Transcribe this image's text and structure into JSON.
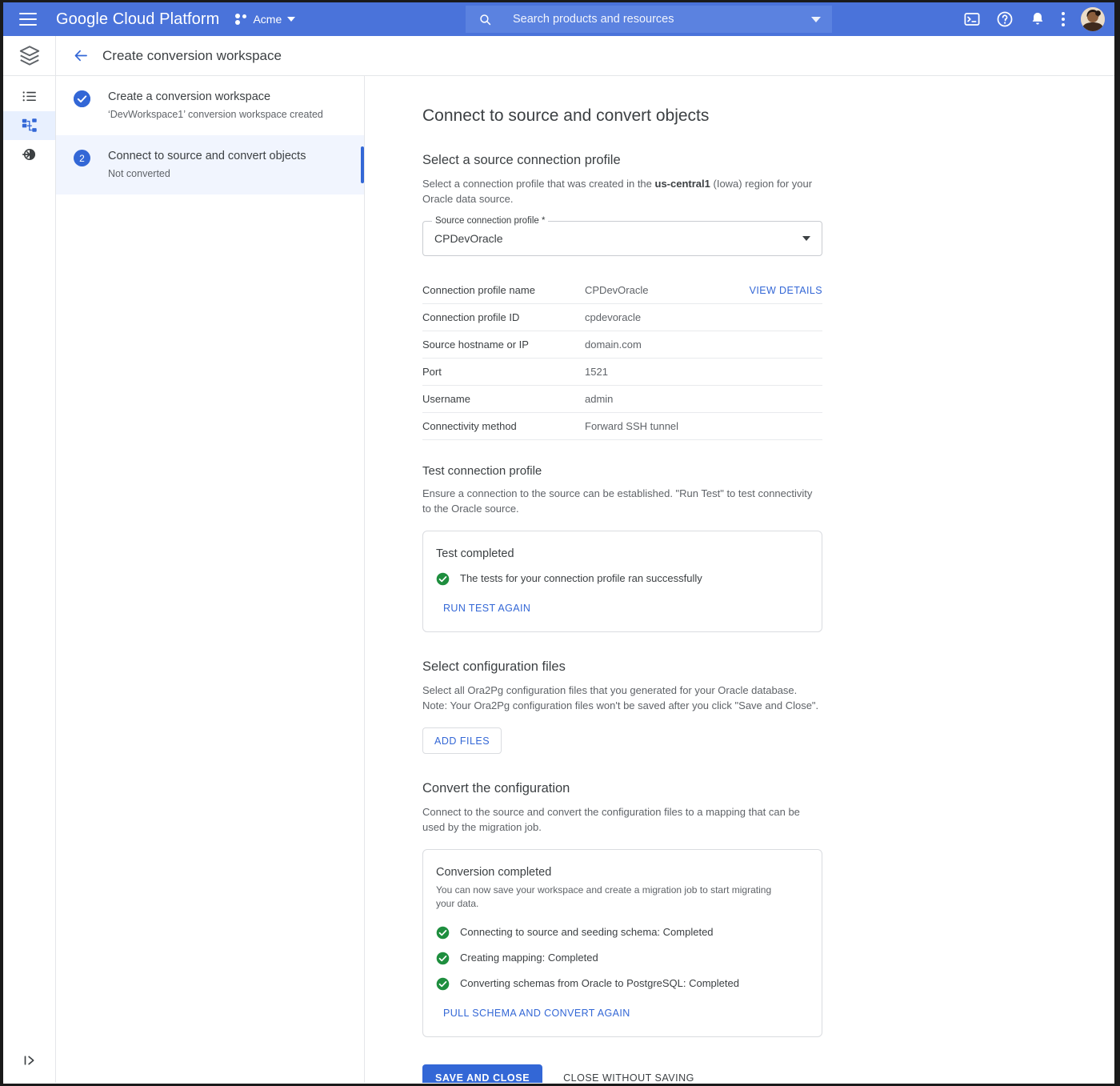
{
  "topbar": {
    "menu_icon": "hamburger-icon",
    "brand_bold": "Google",
    "brand_rest": " Cloud Platform",
    "project_name": "Acme",
    "search_placeholder": "Search products and resources",
    "icons": [
      "terminal-icon",
      "help-icon",
      "notifications-icon",
      "more-options-icon",
      "user-avatar"
    ]
  },
  "subheader": {
    "back_label": "back-arrow",
    "title": "Create conversion workspace"
  },
  "rail": {
    "items": [
      {
        "name": "list-icon",
        "active": false
      },
      {
        "name": "conversion-workspace-icon",
        "active": true
      },
      {
        "name": "migration-job-icon",
        "active": false
      }
    ],
    "expand_icon": "expand-panel-icon"
  },
  "steps": [
    {
      "marker": "check",
      "title": "Create a conversion workspace",
      "subtitle": "‘DevWorkspace1’ conversion workspace created",
      "active": false
    },
    {
      "marker": "2",
      "title": "Connect to source and convert objects",
      "subtitle": "Not converted",
      "active": true
    }
  ],
  "main": {
    "page_title": "Connect to source and convert objects",
    "source_section": {
      "heading": "Select a source connection profile",
      "desc_before": "Select a connection profile that was created in the ",
      "desc_bold": "us-central1",
      "desc_after": " (Iowa) region for your Oracle data source.",
      "field_label": "Source connection profile *",
      "field_value": "CPDevOracle"
    },
    "details_table": {
      "rows": [
        {
          "key": "Connection profile name",
          "value": "CPDevOracle",
          "action": "VIEW DETAILS"
        },
        {
          "key": "Connection profile ID",
          "value": "cpdevoracle",
          "action": ""
        },
        {
          "key": "Source hostname or IP",
          "value": "domain.com",
          "action": ""
        },
        {
          "key": "Port",
          "value": "1521",
          "action": ""
        },
        {
          "key": "Username",
          "value": "admin",
          "action": ""
        },
        {
          "key": "Connectivity method",
          "value": "Forward SSH tunnel",
          "action": ""
        }
      ]
    },
    "test_section": {
      "heading": "Test connection profile",
      "desc": "Ensure a connection to the source can be established. \"Run Test\" to test connectivity to the Oracle source.",
      "card_title": "Test completed",
      "status_text": "The tests for your connection profile ran successfully",
      "link": "RUN TEST AGAIN"
    },
    "config_section": {
      "heading": "Select configuration files",
      "desc_line1": "Select all Ora2Pg configuration files that you generated for your Oracle database.",
      "desc_line2": "Note: Your Ora2Pg configuration files won't be saved after you click \"Save and Close\".",
      "button": "ADD FILES"
    },
    "convert_section": {
      "heading": "Convert the configuration",
      "desc": "Connect to the source and convert the configuration files to a mapping that can be used by the migration job.",
      "card_title": "Conversion completed",
      "card_sub": "You can now save your workspace and create a migration job to start migrating your data.",
      "statuses": [
        "Connecting to source and seeding schema: Completed",
        "Creating mapping: Completed",
        "Converting schemas from Oracle to PostgreSQL: Completed"
      ],
      "link": "PULL SCHEMA AND CONVERT AGAIN"
    },
    "actions": {
      "primary": "SAVE AND CLOSE",
      "secondary": "CLOSE WITHOUT SAVING"
    }
  },
  "colors": {
    "header_blue": "#4a73da",
    "accent_blue": "#3367d6",
    "success_green": "#1e8e3e",
    "text_primary": "#3c4043",
    "text_secondary": "#5f6368"
  }
}
